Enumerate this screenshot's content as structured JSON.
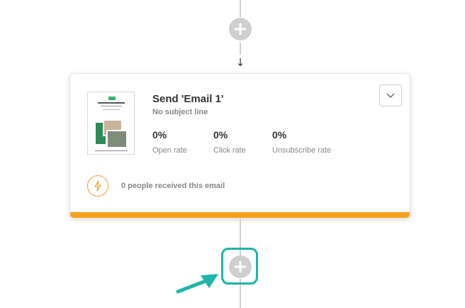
{
  "flow": {
    "top_add_symbol": "+",
    "arrow_symbol": "↓",
    "bottom_add_symbol": "+"
  },
  "card": {
    "title": "Send 'Email 1'",
    "subtitle": "No subject line",
    "stats": [
      {
        "value": "0%",
        "label": "Open rate"
      },
      {
        "value": "0%",
        "label": "Click rate"
      },
      {
        "value": "0%",
        "label": "Unsubscribe rate"
      }
    ],
    "received_text": "0 people received this email",
    "dropdown_icon": "chevron-down-icon",
    "status_icon": "lightning-bolt-icon"
  },
  "colors": {
    "accent_orange": "#f7a01c",
    "highlight_teal": "#1fb5a8",
    "add_button_gray": "#cfcfcf"
  }
}
